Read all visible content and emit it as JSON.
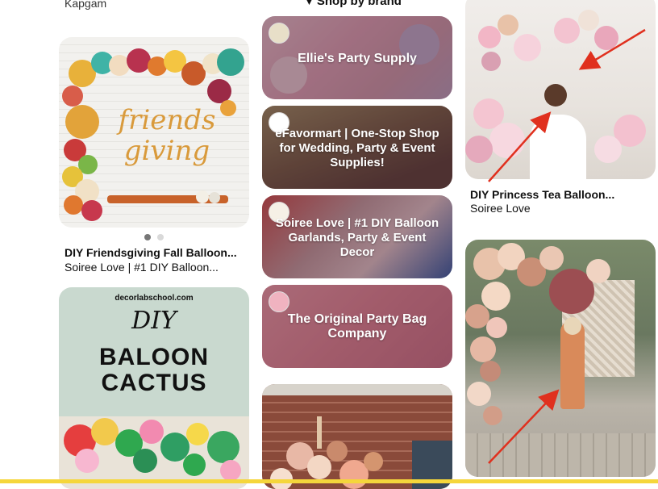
{
  "top_cut_text": "Kapgam",
  "shop_heading": "Shop by brand",
  "brands": [
    {
      "name": "Ellie's Party Supply",
      "logo": "ellie-logo"
    },
    {
      "name": "eFavormart | One-Stop Shop for Wedding, Party & Event Supplies!",
      "logo": "efavormart-logo"
    },
    {
      "name": "Soiree Love | #1 DIY Balloon Garlands, Party & Event Decor",
      "logo": "soiree-love-logo"
    },
    {
      "name": "The Original Party Bag Company",
      "logo": "party-bag-logo"
    }
  ],
  "pins": {
    "friendsgiving": {
      "image_text": "friends giving",
      "title": "DIY Friendsgiving Fall Balloon...",
      "subtitle": "Soiree Love | #1 DIY Balloon...",
      "carousel_pages": 2,
      "carousel_active": 1
    },
    "cactus": {
      "site": "decorlabschool.com",
      "line1": "DIY",
      "line2": "BALOON",
      "line3": "CACTUS"
    },
    "princess": {
      "title": "DIY Princess Tea Balloon...",
      "subtitle": "Soiree Love"
    }
  },
  "annotation_color": "#e0301e",
  "accent_bar_color": "#f5d63b"
}
